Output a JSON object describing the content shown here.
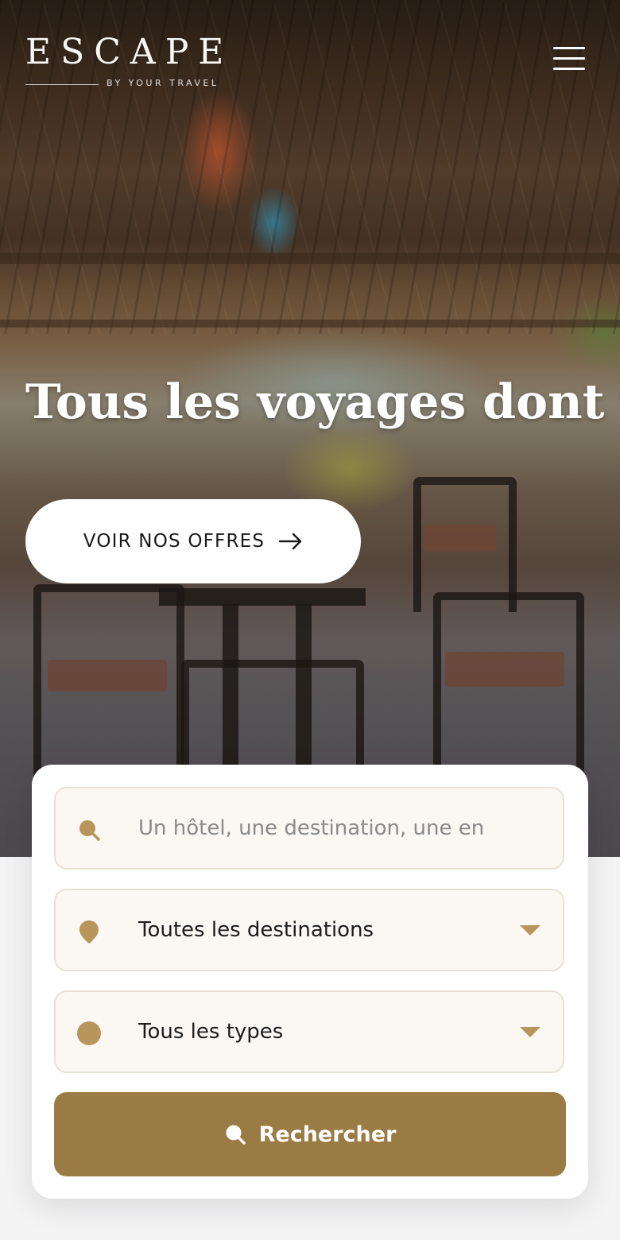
{
  "header": {
    "logo_title": "ESCAPE",
    "logo_subtitle": "BY YOUR TRAVEL",
    "menu_icon": "hamburger-menu-icon"
  },
  "hero": {
    "headline": "Tous les voyages dont vou",
    "cta_label": "VOIR NOS OFFRES",
    "cta_icon": "arrow-right-icon"
  },
  "search": {
    "query_placeholder": "Un hôtel, une destination, une en",
    "query_icon": "search-icon",
    "destination_value": "Toutes les destinations",
    "destination_icon": "location-pin-icon",
    "type_value": "Tous les types",
    "type_icon": "circle-icon",
    "submit_label": "Rechercher",
    "submit_icon": "search-icon"
  },
  "colors": {
    "accent": "#9a7b43",
    "icon_gold": "#b8955a",
    "field_bg": "#fbf8f4",
    "page_bg": "#f3f3f4"
  }
}
